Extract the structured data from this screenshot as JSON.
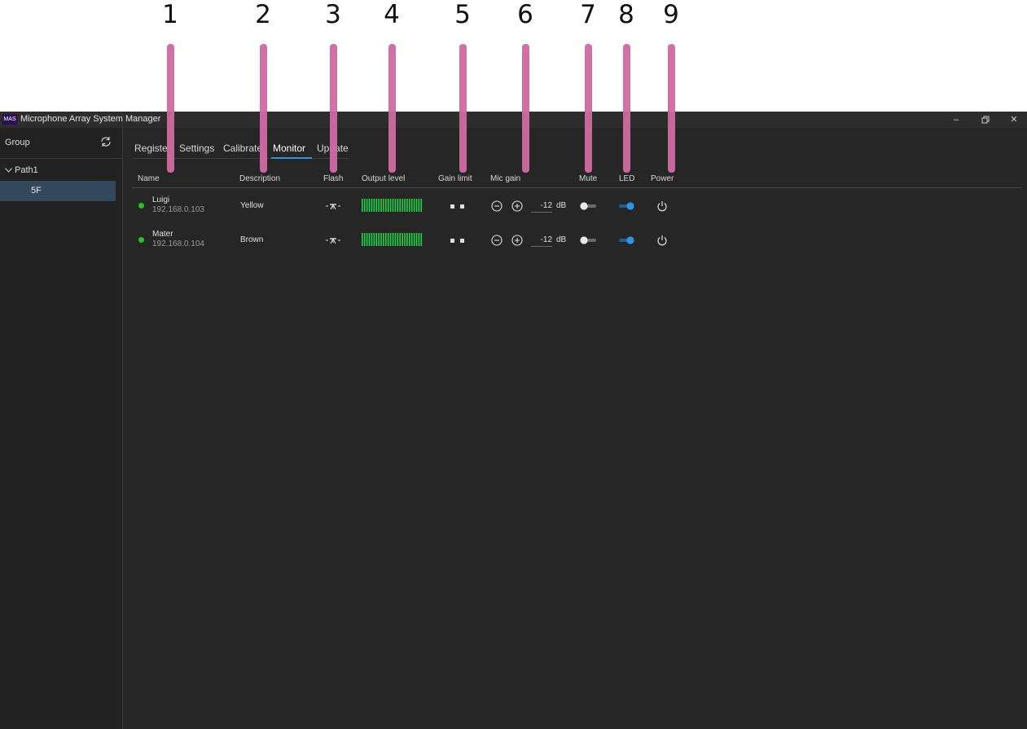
{
  "callouts": [
    "1",
    "2",
    "3",
    "4",
    "5",
    "6",
    "7",
    "8",
    "9"
  ],
  "window": {
    "logo": "MAS",
    "title": "Microphone Array System Manager",
    "controls": {
      "minimize": "minimize-icon",
      "restore": "restore-icon",
      "close": "close-icon"
    }
  },
  "sidebar": {
    "header": "Group",
    "refresh_icon": "refresh-icon",
    "tree": {
      "path_label": "Path1",
      "item_label": "5F"
    }
  },
  "tabs": [
    {
      "label": "Register",
      "active": false
    },
    {
      "label": "Settings",
      "active": false
    },
    {
      "label": "Calibrate",
      "active": false
    },
    {
      "label": "Monitor",
      "active": true
    },
    {
      "label": "Update",
      "active": false
    }
  ],
  "columns": {
    "name": "Name",
    "description": "Description",
    "flash": "Flash",
    "output_level": "Output level",
    "gain_limit": "Gain limit",
    "mic_gain": "Mic gain",
    "mute": "Mute",
    "led": "LED",
    "power": "Power"
  },
  "devices": [
    {
      "name": "Luigi",
      "ip": "192.168.0.103",
      "description": "Yellow",
      "status_color": "#26c32b",
      "output_level": 1.0,
      "mic_gain_value": "-12",
      "mic_gain_unit": "dB",
      "mute": false,
      "led": true
    },
    {
      "name": "Mater",
      "ip": "192.168.0.104",
      "description": "Brown",
      "status_color": "#26c32b",
      "output_level": 1.0,
      "mic_gain_value": "-12",
      "mic_gain_unit": "dB",
      "mute": false,
      "led": true
    }
  ],
  "colors": {
    "accent": "#2b95e8",
    "meter": "#1fd34a",
    "marker": "#cf6aa0",
    "online": "#26c32b"
  }
}
